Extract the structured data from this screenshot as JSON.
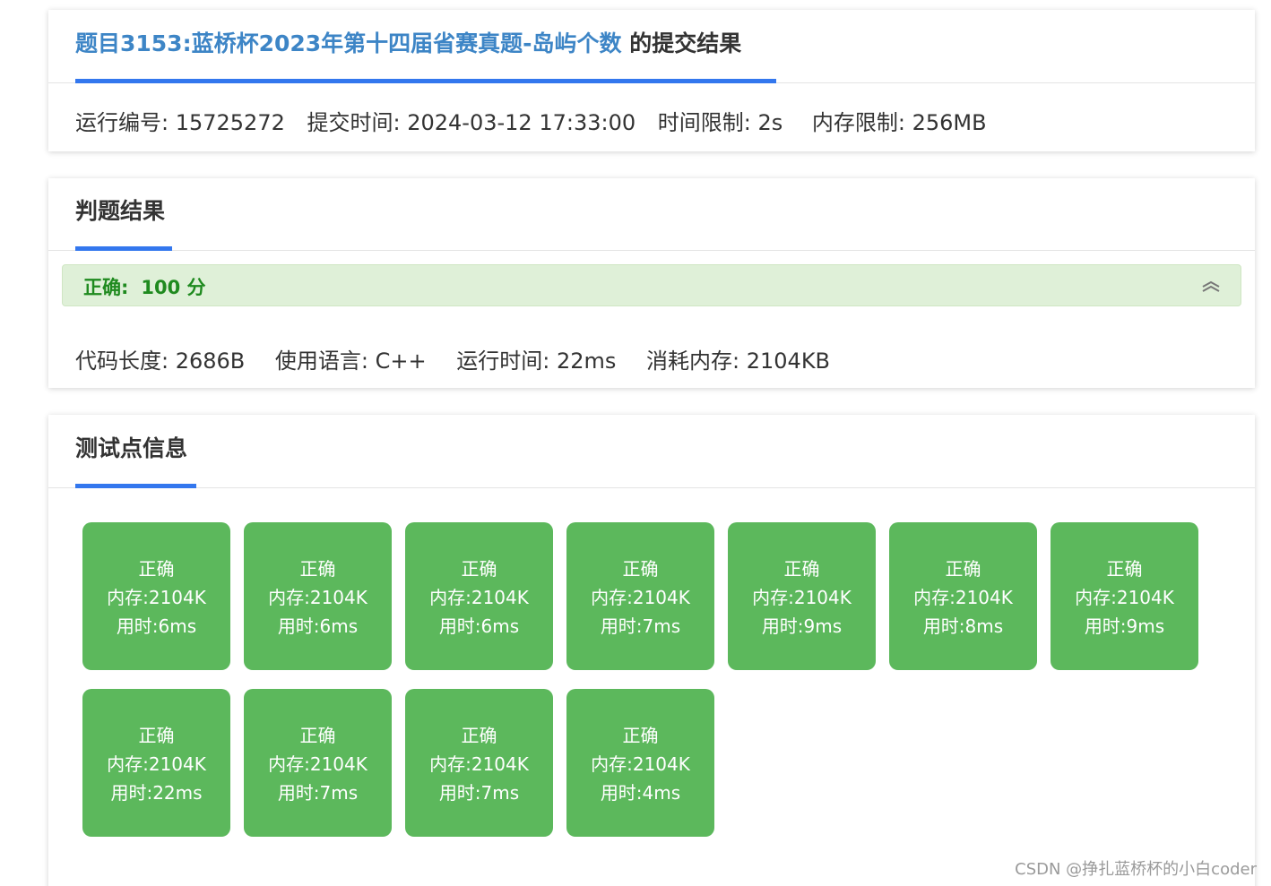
{
  "submission": {
    "problem_link": "题目3153:蓝桥杯2023年第十四届省赛真题-岛屿个数",
    "title_suffix": " 的提交结果",
    "run_id": "运行编号: 15725272",
    "submit_time": "提交时间: 2024-03-12 17:33:00",
    "time_limit": "时间限制: 2s",
    "memory_limit": "内存限制: 256MB"
  },
  "judge": {
    "title": "判题结果",
    "status_label": "正确:",
    "score": "100 分",
    "code_length": "代码长度: 2686B",
    "language": "使用语言: C++",
    "run_time": "运行时间: 22ms",
    "memory_used": "消耗内存: 2104KB",
    "collapse_icon": "chevron-double-up-icon"
  },
  "tests": {
    "title": "测试点信息",
    "items": [
      {
        "status": "正确",
        "memory": "内存:2104K",
        "time": "用时:6ms"
      },
      {
        "status": "正确",
        "memory": "内存:2104K",
        "time": "用时:6ms"
      },
      {
        "status": "正确",
        "memory": "内存:2104K",
        "time": "用时:6ms"
      },
      {
        "status": "正确",
        "memory": "内存:2104K",
        "time": "用时:7ms"
      },
      {
        "status": "正确",
        "memory": "内存:2104K",
        "time": "用时:9ms"
      },
      {
        "status": "正确",
        "memory": "内存:2104K",
        "time": "用时:8ms"
      },
      {
        "status": "正确",
        "memory": "内存:2104K",
        "time": "用时:9ms"
      },
      {
        "status": "正确",
        "memory": "内存:2104K",
        "time": "用时:22ms"
      },
      {
        "status": "正确",
        "memory": "内存:2104K",
        "time": "用时:7ms"
      },
      {
        "status": "正确",
        "memory": "内存:2104K",
        "time": "用时:7ms"
      },
      {
        "status": "正确",
        "memory": "内存:2104K",
        "time": "用时:4ms"
      }
    ]
  },
  "watermark": "CSDN @挣扎蓝桥杯的小白coder",
  "colors": {
    "accent": "#3377ee",
    "link": "#3d85c6",
    "success_box": "#5cb85c",
    "success_bg": "#dff0d8",
    "success_text": "#1f8a1f"
  }
}
